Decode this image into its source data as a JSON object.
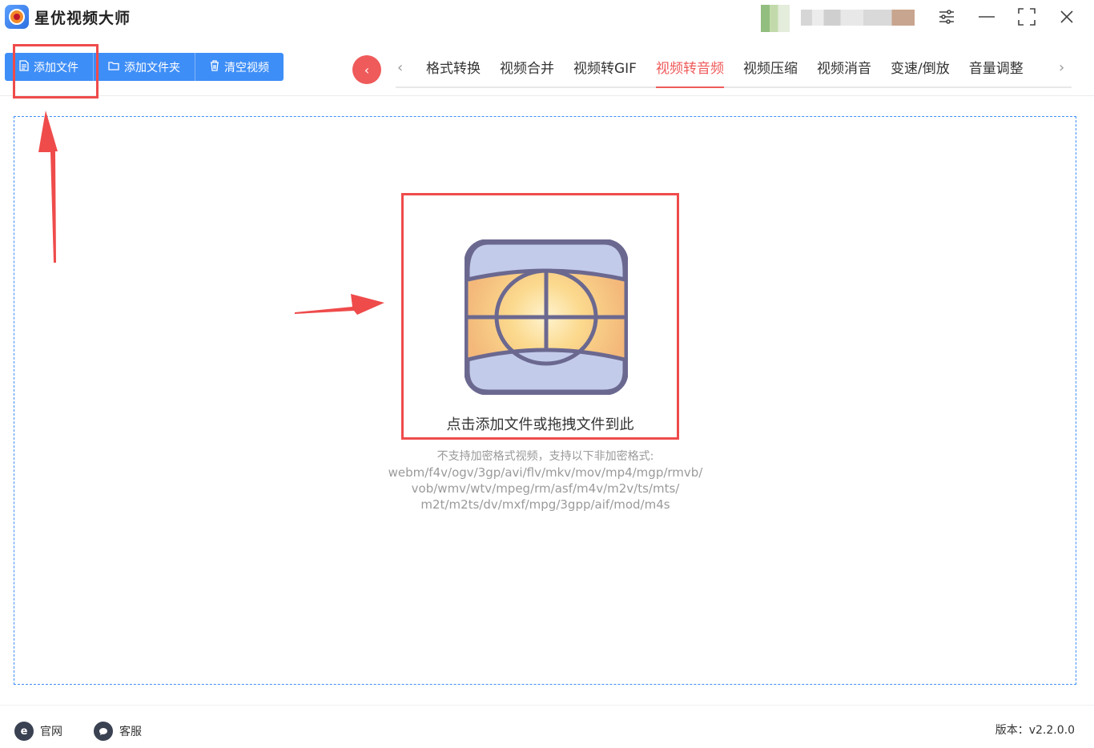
{
  "app": {
    "title": "星优视频大师"
  },
  "window_controls": {
    "settings_icon": "sliders-icon",
    "minimize_icon": "minimize-icon",
    "maximize_icon": "maximize-icon",
    "close_icon": "close-icon"
  },
  "toolbar": {
    "add_file_label": "添加文件",
    "add_folder_label": "添加文件夹",
    "clear_label": "清空视频"
  },
  "tabs": [
    {
      "label": "格式转换",
      "active": false
    },
    {
      "label": "视频合并",
      "active": false
    },
    {
      "label": "视频转GIF",
      "active": false
    },
    {
      "label": "视频转音频",
      "active": true
    },
    {
      "label": "视频压缩",
      "active": false
    },
    {
      "label": "视频消音",
      "active": false
    },
    {
      "label": "变速/倒放",
      "active": false
    },
    {
      "label": "音量调整",
      "active": false
    }
  ],
  "dropzone": {
    "main_text": "点击添加文件或拖拽文件到此",
    "support_title": "不支持加密格式视频，支持以下非加密格式:",
    "formats_line1": "webm/f4v/ogv/3gp/avi/flv/mkv/mov/mp4/mgp/rmvb/",
    "formats_line2": "vob/wmv/wtv/mpeg/rm/asf/m4v/m2v/ts/mts/",
    "formats_line3": "m2t/m2ts/dv/mxf/mpg/3gpp/aif/mod/m4s"
  },
  "footer": {
    "website_label": "官网",
    "support_label": "客服",
    "version_text": "版本：v2.2.0.0"
  },
  "colors": {
    "accent_blue": "#3e8ef7",
    "accent_red": "#ef5a5a"
  }
}
